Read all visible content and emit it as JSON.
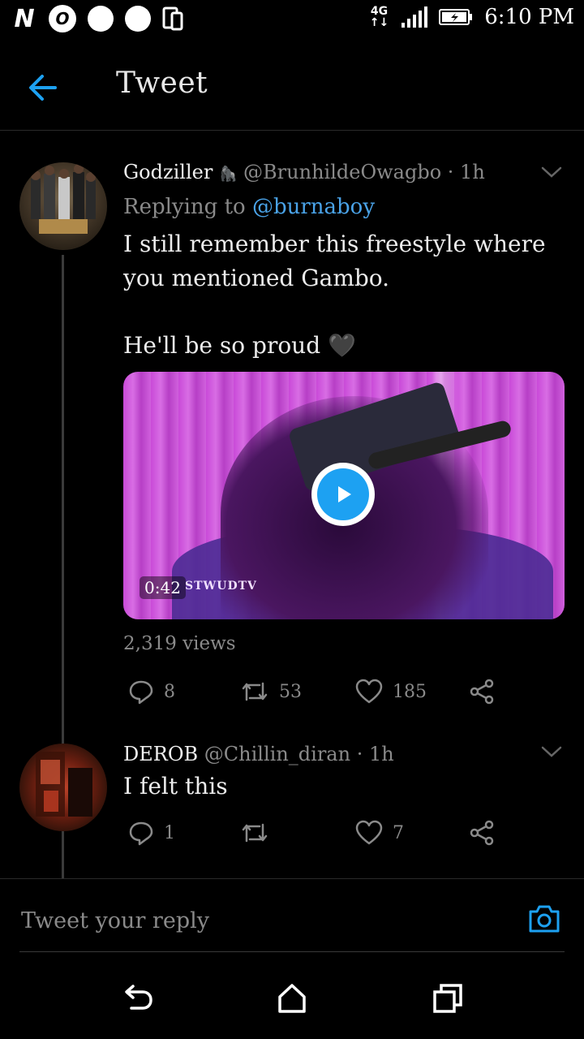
{
  "status_bar": {
    "time": "6:10 PM",
    "network": "4G",
    "left_icons": [
      "n-notification-icon",
      "opera-icon",
      "circle-notification-icon",
      "circle-notification-icon",
      "screenshot-icon"
    ]
  },
  "header": {
    "title": "Tweet"
  },
  "tweets": [
    {
      "display_name": "Godziller",
      "emoji": "🦍",
      "handle": "@BrunhildeOwagbo",
      "time": "· 1h",
      "replying_prefix": "Replying to",
      "replying_to": "@burnaboy",
      "text_line1": "I still remember this freestyle where you mentioned Gambo.",
      "text_line2": "He'll be so proud",
      "heart_emoji": "🖤",
      "video": {
        "duration": "0:42",
        "watermark": "STWUDTV"
      },
      "views": "2,319 views",
      "replies": "8",
      "retweets": "53",
      "likes": "185"
    },
    {
      "display_name": "DEROB",
      "handle": "@Chillin_diran",
      "time": "· 1h",
      "text": "I felt this",
      "replies": "1",
      "retweets": "",
      "likes": "7"
    }
  ],
  "reply_box": {
    "placeholder": "Tweet your reply"
  },
  "colors": {
    "background": "#000000",
    "accent": "#1da1f2",
    "link": "#4aa3e8",
    "muted": "#8a8a8a"
  }
}
